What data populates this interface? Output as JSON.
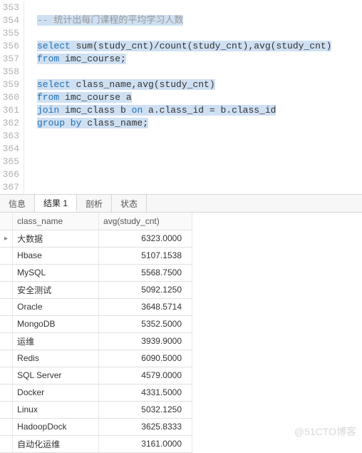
{
  "editor": {
    "line_start": 353,
    "line_end": 367,
    "lines": [
      {
        "n": 353,
        "segs": []
      },
      {
        "n": 354,
        "segs": [
          {
            "t": "-- 统计出每门课程的平均学习人数",
            "c": "sql-cm",
            "sel": true
          }
        ]
      },
      {
        "n": 355,
        "segs": []
      },
      {
        "n": 356,
        "segs": [
          {
            "t": "select ",
            "c": "sql-kw",
            "sel": true
          },
          {
            "t": "sum(study_cnt)/count(study_cnt),avg(study_cnt)",
            "c": "sql-tx",
            "sel": true
          }
        ]
      },
      {
        "n": 357,
        "segs": [
          {
            "t": "from ",
            "c": "sql-kw",
            "sel": true
          },
          {
            "t": "imc_course;",
            "c": "sql-tx",
            "sel": true
          }
        ]
      },
      {
        "n": 358,
        "segs": []
      },
      {
        "n": 359,
        "segs": [
          {
            "t": "select ",
            "c": "sql-kw",
            "sel": true
          },
          {
            "t": "class_name,avg(study_cnt)",
            "c": "sql-tx",
            "sel": true
          }
        ]
      },
      {
        "n": 360,
        "segs": [
          {
            "t": "from ",
            "c": "sql-kw",
            "sel": true
          },
          {
            "t": "imc_course a",
            "c": "sql-tx",
            "sel": true
          }
        ]
      },
      {
        "n": 361,
        "segs": [
          {
            "t": "join ",
            "c": "sql-kw",
            "sel": true
          },
          {
            "t": "imc_class b ",
            "c": "sql-tx",
            "sel": true
          },
          {
            "t": "on ",
            "c": "sql-kw",
            "sel": true
          },
          {
            "t": "a.class_id = b.class_id",
            "c": "sql-tx",
            "sel": true
          }
        ]
      },
      {
        "n": 362,
        "segs": [
          {
            "t": "group by ",
            "c": "sql-kw",
            "sel": true
          },
          {
            "t": "class_name;",
            "c": "sql-tx",
            "sel": true
          }
        ]
      },
      {
        "n": 363,
        "segs": []
      },
      {
        "n": 364,
        "segs": []
      },
      {
        "n": 365,
        "segs": []
      },
      {
        "n": 366,
        "segs": []
      },
      {
        "n": 367,
        "segs": []
      }
    ]
  },
  "tabs": {
    "items": [
      "信息",
      "结果 1",
      "剖析",
      "状态"
    ],
    "active_index": 1
  },
  "result": {
    "columns": [
      "class_name",
      "avg(study_cnt)"
    ],
    "rows": [
      {
        "class_name": "大数据",
        "avg": "6323.0000",
        "current": true
      },
      {
        "class_name": "Hbase",
        "avg": "5107.1538"
      },
      {
        "class_name": "MySQL",
        "avg": "5568.7500"
      },
      {
        "class_name": "安全测试",
        "avg": "5092.1250"
      },
      {
        "class_name": "Oracle",
        "avg": "3648.5714"
      },
      {
        "class_name": "MongoDB",
        "avg": "5352.5000"
      },
      {
        "class_name": "运维",
        "avg": "3939.9000"
      },
      {
        "class_name": "Redis",
        "avg": "6090.5000"
      },
      {
        "class_name": "SQL Server",
        "avg": "4579.0000"
      },
      {
        "class_name": "Docker",
        "avg": "4331.5000"
      },
      {
        "class_name": "Linux",
        "avg": "5032.1250"
      },
      {
        "class_name": "HadoopDock",
        "avg": "3625.8333"
      },
      {
        "class_name": "自动化运维",
        "avg": "3161.0000"
      }
    ]
  },
  "watermark": "@51CTO博客",
  "chart_data": {
    "type": "table",
    "title": "avg(study_cnt) by class_name",
    "columns": [
      "class_name",
      "avg(study_cnt)"
    ],
    "rows": [
      [
        "大数据",
        6323.0
      ],
      [
        "Hbase",
        5107.1538
      ],
      [
        "MySQL",
        5568.75
      ],
      [
        "安全测试",
        5092.125
      ],
      [
        "Oracle",
        3648.5714
      ],
      [
        "MongoDB",
        5352.5
      ],
      [
        "运维",
        3939.9
      ],
      [
        "Redis",
        6090.5
      ],
      [
        "SQL Server",
        4579.0
      ],
      [
        "Docker",
        4331.5
      ],
      [
        "Linux",
        5032.125
      ],
      [
        "HadoopDock",
        3625.8333
      ],
      [
        "自动化运维",
        3161.0
      ]
    ]
  }
}
